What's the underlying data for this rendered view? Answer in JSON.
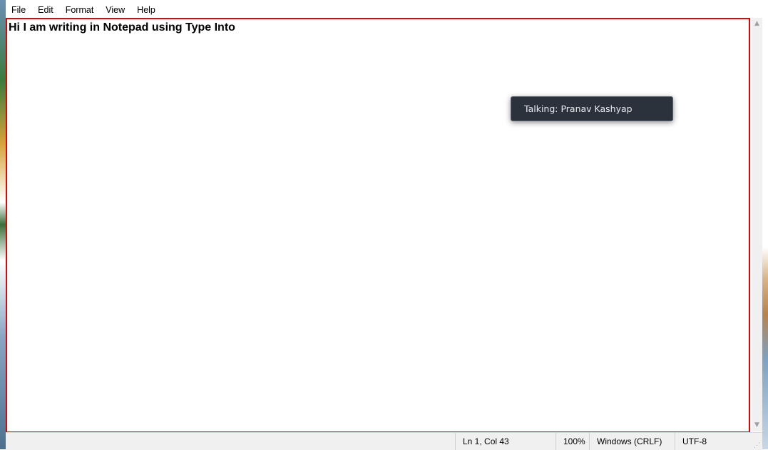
{
  "menu": {
    "file": "File",
    "edit": "Edit",
    "format": "Format",
    "view": "View",
    "help": "Help"
  },
  "editor": {
    "content": "Hi I am writing in Notepad using Type Into"
  },
  "tooltip": {
    "text": "Talking: Pranav Kashyap"
  },
  "status": {
    "position": "Ln 1, Col 43",
    "zoom": "100%",
    "line_ending": "Windows (CRLF)",
    "encoding": "UTF-8"
  },
  "colors": {
    "selection_border": "#e60000",
    "tooltip_bg": "#2b323b"
  }
}
